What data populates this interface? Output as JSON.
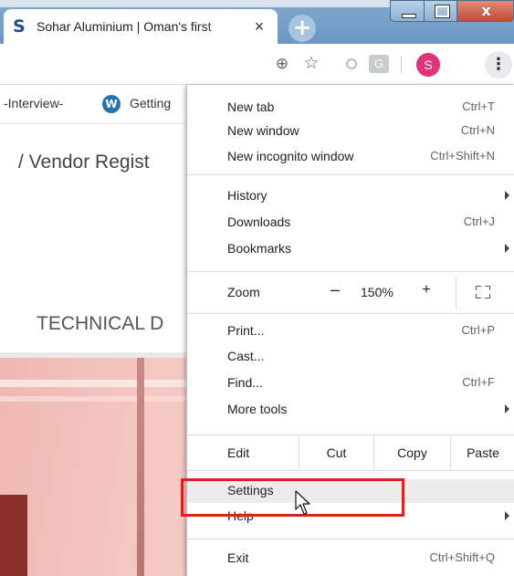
{
  "browser": {
    "tab_title": "Sohar Aluminium | Oman's first",
    "tab_favicon": "S",
    "tab_close": "×",
    "new_tab": "+",
    "window_close": "x"
  },
  "toolbar": {
    "zoom_icon": "zoom-magnifier-icon",
    "star_icon": "☆",
    "ext2_label": "G",
    "avatar_letter": "S",
    "menu_icon": "⋮"
  },
  "bookmarks": {
    "item1": "-Interview-",
    "item1_sep": "-",
    "wp_letter": "W",
    "item2": "Getting"
  },
  "page": {
    "breadcrumb": "/  Vendor Regist",
    "section_heading": "TECHNICAL D"
  },
  "menu": {
    "new_tab": {
      "label": "New tab",
      "shortcut": "Ctrl+T"
    },
    "new_window": {
      "label": "New window",
      "shortcut": "Ctrl+N"
    },
    "incognito": {
      "label": "New incognito window",
      "shortcut": "Ctrl+Shift+N"
    },
    "history": {
      "label": "History"
    },
    "downloads": {
      "label": "Downloads",
      "shortcut": "Ctrl+J"
    },
    "bookmarks": {
      "label": "Bookmarks"
    },
    "zoom": {
      "label": "Zoom",
      "minus": "–",
      "value": "150%",
      "plus": "+"
    },
    "print": {
      "label": "Print...",
      "shortcut": "Ctrl+P"
    },
    "cast": {
      "label": "Cast..."
    },
    "find": {
      "label": "Find...",
      "shortcut": "Ctrl+F"
    },
    "more_tools": {
      "label": "More tools"
    },
    "edit": {
      "label": "Edit",
      "cut": "Cut",
      "copy": "Copy",
      "paste": "Paste"
    },
    "settings": {
      "label": "Settings"
    },
    "help": {
      "label": "Help"
    },
    "exit": {
      "label": "Exit",
      "shortcut": "Ctrl+Shift+Q"
    }
  },
  "colors": {
    "highlight": "#e0201c",
    "avatar": "#e0347a",
    "titlebar": "#7fa9cf"
  }
}
